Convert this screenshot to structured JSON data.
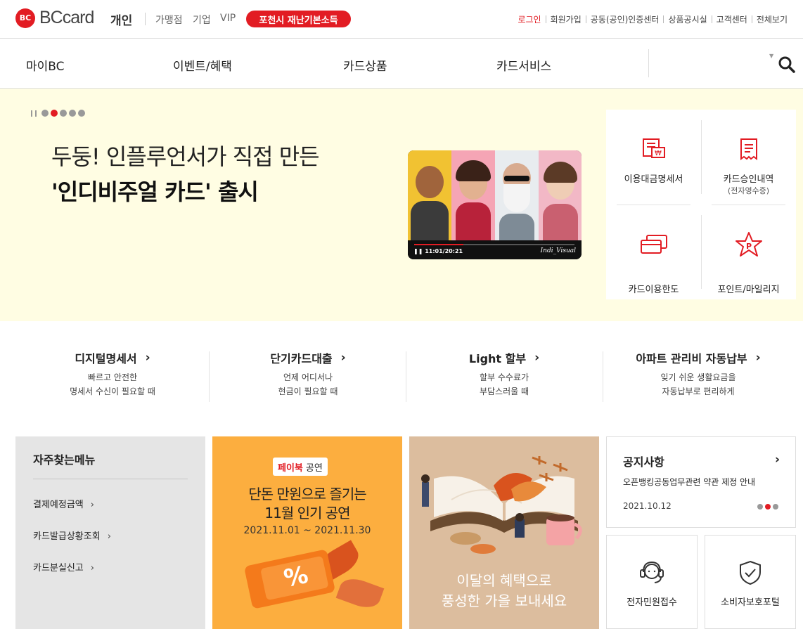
{
  "header": {
    "logo_badge": "BC",
    "logo_text": "BCcard",
    "section": "개인",
    "links": [
      "가맹점",
      "기업",
      "VIP"
    ],
    "promo": "포천시 재난기본소득",
    "util": [
      "로그인",
      "회원가입",
      "공동(공인)인증센터",
      "상품공시실",
      "고객센터",
      "전체보기"
    ]
  },
  "gnb": {
    "items": [
      "마이BC",
      "이벤트/혜택",
      "카드상품",
      "카드서비스"
    ]
  },
  "hero": {
    "line1": "두둥! 인플루언서가 직접 만든",
    "line2": "'인디비주얼 카드' 출시",
    "video_time": "11:01/20:21",
    "video_brand": "Indi_Visual",
    "slide_count": 5,
    "active_slide": 2
  },
  "quick": [
    {
      "label": "이용대금명세서",
      "sub": "",
      "icon": "statement-icon"
    },
    {
      "label": "카드승인내역",
      "sub": "(전자영수증)",
      "icon": "receipt-icon"
    },
    {
      "label": "카드이용한도",
      "sub": "",
      "icon": "card-limit-icon"
    },
    {
      "label": "포인트/마일리지",
      "sub": "",
      "icon": "point-star-icon"
    }
  ],
  "services": [
    {
      "title": "디지털명세서",
      "d1": "빠르고 안전한",
      "d2": "명세서 수신이 필요할 때"
    },
    {
      "title": "단기카드대출",
      "d1": "언제 어디서나",
      "d2": "현금이 필요할 때"
    },
    {
      "title": "Light 할부",
      "d1": "할부 수수료가",
      "d2": "부담스러울 때"
    },
    {
      "title": "아파트 관리비 자동납부",
      "d1": "잊기 쉬운 생활요금을",
      "d2": "자동납부로 편리하게"
    }
  ],
  "frequent": {
    "title": "자주찾는메뉴",
    "items": [
      "결제예정금액",
      "카드발급상황조회",
      "카드분실신고"
    ]
  },
  "ticket": {
    "brand": "페이북",
    "brand_tail": "공연",
    "line1": "단돈 만원으로 즐기는",
    "line2": "11월 인기 공연",
    "period": "2021.11.01 ~ 2021.11.30",
    "percent": "%"
  },
  "book": {
    "line1": "이달의 혜택으로",
    "line2": "풍성한 가을 보내세요"
  },
  "notice": {
    "title": "공지사항",
    "body": "오픈뱅킹공동업무관련 약관 제정 안내",
    "date": "2021.10.12"
  },
  "support": [
    {
      "label": "전자민원접수",
      "icon": "headset-icon"
    },
    {
      "label": "소비자보호포털",
      "icon": "shield-check-icon"
    }
  ],
  "colors": {
    "brand": "#e21c23",
    "hero_bg": "#fffde3",
    "ticket_bg": "#fcae3f",
    "book_bg": "#dcbd9e"
  }
}
